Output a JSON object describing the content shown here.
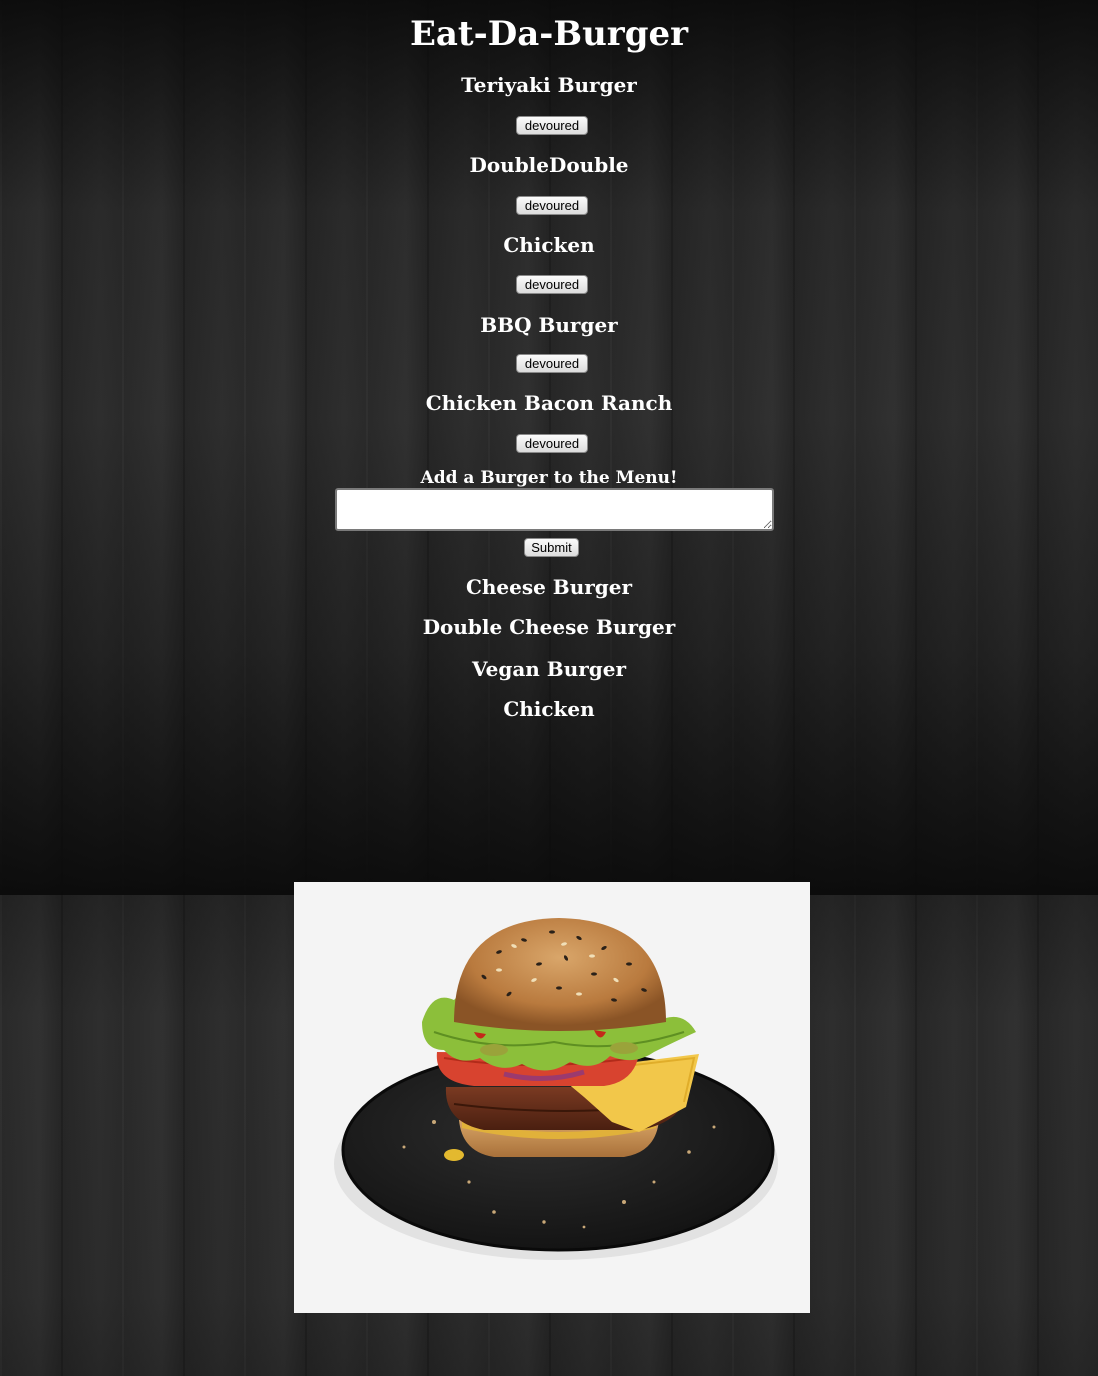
{
  "page": {
    "title": "Eat-Da-Burger"
  },
  "menu": {
    "burgers": [
      {
        "name": "Teriyaki Burger",
        "button_label": "devoured"
      },
      {
        "name": "DoubleDouble",
        "button_label": "devoured"
      },
      {
        "name": "Chicken",
        "button_label": "devoured"
      },
      {
        "name": "BBQ Burger",
        "button_label": "devoured"
      },
      {
        "name": "Chicken Bacon Ranch",
        "button_label": "devoured"
      }
    ]
  },
  "form": {
    "label": "Add a Burger to the Menu!",
    "textarea_value": "",
    "submit_label": "Submit"
  },
  "devoured": {
    "burgers": [
      "Cheese Burger",
      "Double Cheese Burger",
      "Vegan Burger",
      "Chicken"
    ]
  },
  "image": {
    "subject": "burger-on-slate-plate"
  },
  "colors": {
    "text": "#ffffff",
    "background": "#2a2a2a",
    "photo_background": "#f4f4f4"
  }
}
